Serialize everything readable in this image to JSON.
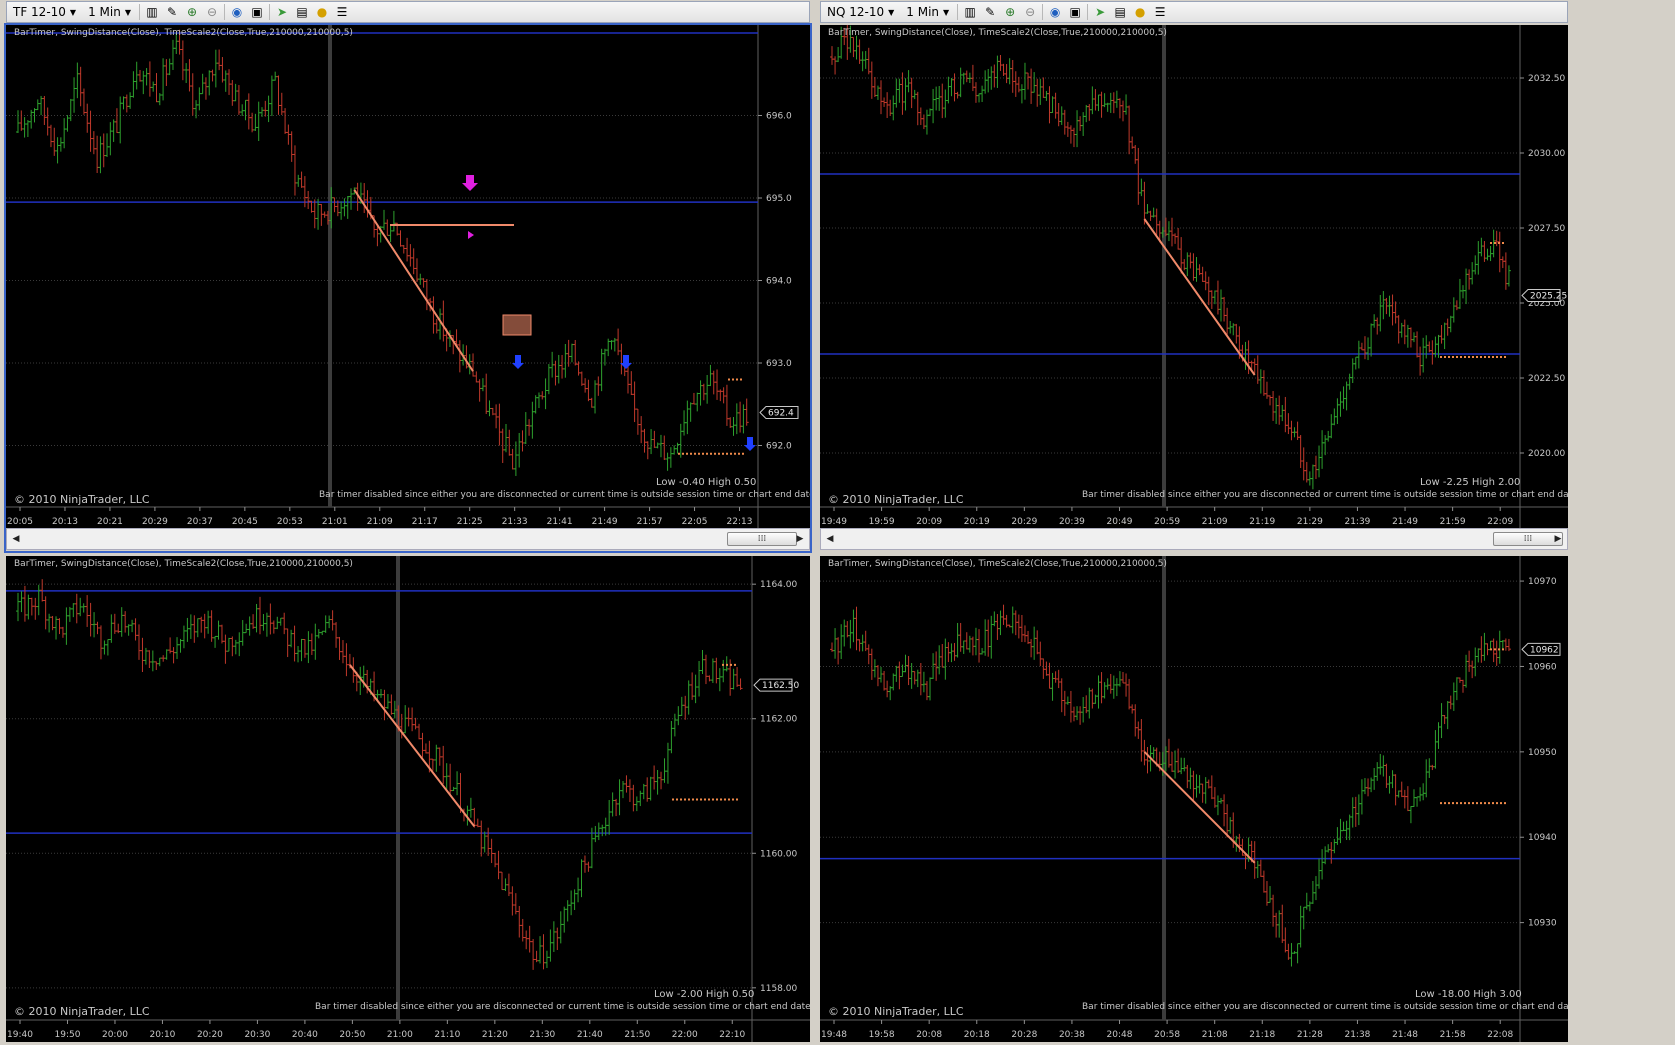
{
  "toolbars": [
    {
      "instrument": "TF 12-10",
      "interval": "1 Min"
    },
    {
      "instrument": "NQ 12-10",
      "interval": "1 Min"
    }
  ],
  "toolbar_icons": [
    "bar-type-icon",
    "drawing-pencil-icon",
    "zoom-in-icon",
    "zoom-out-icon",
    "globe-icon",
    "properties-icon",
    "strategy-icon",
    "chart-trader-icon",
    "data-box-icon",
    "list-icon"
  ],
  "panes": [
    {
      "indicators": "BarTimer,  SwingDistance(Close),  TimeScale2(Close,True,210000,210000,5)",
      "copyright": "© 2010 NinjaTrader, LLC",
      "low_high": "Low -0.40   High 0.50",
      "bar_timer": "Bar timer disabled since either you are disconnected or current time is outside session time or chart end date",
      "chart_data": {
        "type": "candlestick",
        "y_ticks": [
          "696.0",
          "695.0",
          "694.0",
          "693.0",
          "692.0"
        ],
        "x_ticks": [
          "20:05",
          "20:13",
          "20:21",
          "20:29",
          "20:37",
          "20:45",
          "20:53",
          "21:01",
          "21:09",
          "21:17",
          "21:25",
          "21:33",
          "21:41",
          "21:49",
          "21:57",
          "22:05",
          "22:13"
        ],
        "last_price": "692.4",
        "ylim": [
          691.4,
          697.0
        ],
        "path": [
          695.8,
          696.2,
          695.6,
          696.4,
          695.5,
          695.9,
          696.6,
          696.3,
          696.8,
          696.1,
          696.7,
          696.2,
          695.9,
          696.4,
          695.3,
          694.8,
          694.9,
          695.1,
          694.6,
          694.7,
          694.2,
          693.6,
          693.2,
          692.9,
          692.3,
          691.8,
          692.4,
          692.9,
          693.1,
          692.6,
          693.4,
          692.5,
          692.0,
          691.9,
          692.6,
          692.8,
          692.3,
          692.4
        ],
        "blue_lines": [
          697.0,
          694.95
        ]
      },
      "colors": {
        "up": "#2ea12e",
        "down": "#c0392b"
      }
    },
    {
      "indicators": "BarTimer,  SwingDistance(Close),  TimeScale2(Close,True,210000,210000,5)",
      "copyright": "© 2010 NinjaTrader, LLC",
      "low_high": "Low -2.25   High 2.00",
      "bar_timer": "Bar timer disabled since either you are disconnected or current time is outside session time or chart end date",
      "chart_data": {
        "type": "candlestick",
        "y_ticks": [
          "2032.50",
          "2030.00",
          "2027.50",
          "2025.00",
          "2022.50",
          "2020.00"
        ],
        "x_ticks": [
          "19:49",
          "19:59",
          "20:09",
          "20:19",
          "20:29",
          "20:39",
          "20:49",
          "20:59",
          "21:09",
          "21:19",
          "21:29",
          "21:39",
          "21:49",
          "21:59",
          "22:09"
        ],
        "last_price": "2025.25",
        "ylim": [
          2018.6,
          2034.0
        ],
        "path": [
          2033.2,
          2033.8,
          2032.6,
          2031.5,
          2032.2,
          2031.0,
          2031.8,
          2032.4,
          2032.1,
          2032.8,
          2032.5,
          2032.2,
          2031.6,
          2030.4,
          2031.8,
          2032.0,
          2031.2,
          2027.8,
          2027.4,
          2026.6,
          2025.8,
          2025.0,
          2023.8,
          2022.6,
          2021.6,
          2020.8,
          2019.2,
          2020.6,
          2022.4,
          2023.6,
          2024.8,
          2024.2,
          2023.2,
          2023.8,
          2025.2,
          2026.4,
          2027.0,
          2025.5
        ],
        "blue_lines": [
          2029.3,
          2023.3
        ]
      },
      "colors": {
        "up": "#2ea12e",
        "down": "#c0392b"
      }
    },
    {
      "indicators": "BarTimer,  SwingDistance(Close),  TimeScale2(Close,True,210000,210000,5)",
      "copyright": "© 2010 NinjaTrader, LLC",
      "low_high": "Low -2.00   High 0.50",
      "bar_timer": "Bar timer disabled since either you are disconnected or current time is outside session time or chart end date",
      "chart_data": {
        "type": "candlestick",
        "y_ticks": [
          "1164.00",
          "1162.00",
          "1160.00",
          "1158.00"
        ],
        "x_ticks": [
          "19:40",
          "19:50",
          "20:00",
          "20:10",
          "20:20",
          "20:30",
          "20:40",
          "20:50",
          "21:00",
          "21:10",
          "21:20",
          "21:30",
          "21:40",
          "21:50",
          "22:00",
          "22:10"
        ],
        "last_price": "1162.50",
        "ylim": [
          1157.7,
          1164.3
        ],
        "path": [
          1163.6,
          1163.8,
          1163.3,
          1163.7,
          1163.2,
          1163.5,
          1163.0,
          1162.9,
          1163.2,
          1163.5,
          1163.1,
          1163.4,
          1163.6,
          1163.2,
          1163.0,
          1163.4,
          1162.8,
          1162.4,
          1162.1,
          1161.8,
          1161.5,
          1161.0,
          1160.4,
          1159.8,
          1159.1,
          1158.4,
          1158.8,
          1159.6,
          1160.3,
          1161.0,
          1160.8,
          1161.2,
          1162.2,
          1162.8,
          1162.6,
          1162.5
        ],
        "blue_lines": [
          1163.9,
          1160.3
        ]
      },
      "colors": {
        "up": "#2ea12e",
        "down": "#c0392b"
      }
    },
    {
      "indicators": "BarTimer,  SwingDistance(Close),  TimeScale2(Close,True,210000,210000,5)",
      "copyright": "© 2010 NinjaTrader, LLC",
      "low_high": "Low -18.00   High 3.00",
      "bar_timer": "Bar timer disabled since either you are disconnected or current time is outside session time or chart end date",
      "chart_data": {
        "type": "candlestick",
        "y_ticks": [
          "10970",
          "10960",
          "10950",
          "10940",
          "10930"
        ],
        "x_ticks": [
          "19:48",
          "19:58",
          "20:08",
          "20:18",
          "20:28",
          "20:38",
          "20:48",
          "20:58",
          "21:08",
          "21:18",
          "21:28",
          "21:38",
          "21:48",
          "21:58",
          "22:08"
        ],
        "last_price": "10962",
        "ylim": [
          10920,
          10972
        ],
        "path": [
          10962,
          10965,
          10961,
          10958,
          10960,
          10957,
          10961,
          10963,
          10962,
          10965,
          10966,
          10962,
          10958,
          10955,
          10956,
          10958,
          10957,
          10950,
          10949,
          10948,
          10946,
          10944,
          10940,
          10937,
          10932,
          10926,
          10933,
          10938,
          10942,
          10946,
          10948,
          10944,
          10944,
          10952,
          10958,
          10961,
          10962,
          10962
        ],
        "blue_lines": [
          10937.5
        ]
      },
      "colors": {
        "up": "#2ea12e",
        "down": "#c0392b"
      }
    }
  ]
}
